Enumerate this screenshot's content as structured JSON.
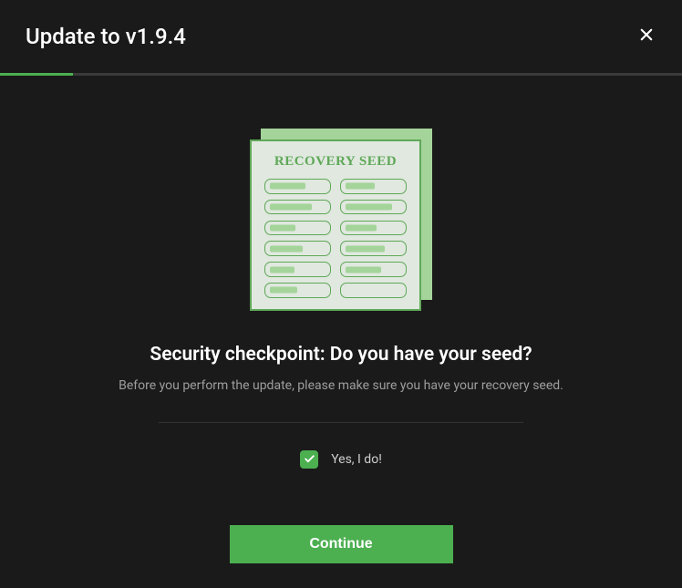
{
  "header": {
    "title": "Update to v1.9.4"
  },
  "progress": {
    "percent": 10.7
  },
  "illustration": {
    "card_title": "RECOVERY SEED"
  },
  "main": {
    "heading": "Security checkpoint: Do you have your seed?",
    "subtext": "Before you perform the update, please make sure you have your recovery seed."
  },
  "confirm": {
    "label": "Yes, I do!",
    "checked": true
  },
  "actions": {
    "continue_label": "Continue"
  },
  "colors": {
    "accent": "#4caf50"
  }
}
